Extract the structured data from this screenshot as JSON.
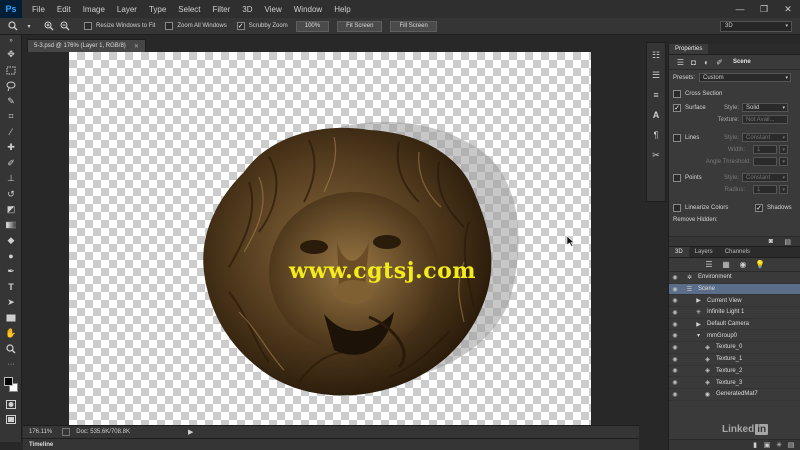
{
  "app": {
    "logo": "Ps",
    "menu": [
      "File",
      "Edit",
      "Image",
      "Layer",
      "Type",
      "Select",
      "Filter",
      "3D",
      "View",
      "Window",
      "Help"
    ],
    "window_controls": [
      "—",
      "❐",
      "✕"
    ]
  },
  "options": {
    "resize_windows": "Resize Windows to Fit",
    "resize_checked": false,
    "zoom_all": "Zoom All Windows",
    "zoom_all_checked": false,
    "scrubby_zoom": "Scrubby Zoom",
    "scrubby_checked": true,
    "btn_100": "100%",
    "btn_fit": "Fit Screen",
    "btn_fill": "Fill Screen",
    "workspace": "3D"
  },
  "document": {
    "tab_title": "5-3.psd @ 176% (Layer 1, RGB/8)",
    "watermark": "www.cgtsj.com"
  },
  "status": {
    "zoom": "176.11%",
    "doc_info": "Doc: 535.6K/708.8K"
  },
  "timeline": {
    "label": "Timeline"
  },
  "properties": {
    "tab": "Properties",
    "header": "Scene",
    "presets_label": "Presets:",
    "presets_value": "Custom",
    "cross_section": "Cross Section",
    "cross_section_checked": false,
    "surface": "Surface",
    "surface_checked": true,
    "surface_style_label": "Style:",
    "surface_style_value": "Solid",
    "texture_label": "Texture:",
    "texture_value": "Not Avail...",
    "lines": "Lines",
    "lines_checked": false,
    "lines_style_label": "Style:",
    "lines_style_value": "Constant",
    "width_label": "Width:",
    "width_value": "1",
    "angle_label": "Angle Threshold:",
    "points": "Points",
    "points_checked": false,
    "points_style_label": "Style:",
    "points_style_value": "Constant",
    "radius_label": "Radius:",
    "radius_value": "1",
    "linearize": "Linearize Colors",
    "linearize_checked": false,
    "shadows": "Shadows",
    "shadows_checked": true,
    "remove_hidden": "Remove Hidden:"
  },
  "panel3d": {
    "tabs": [
      "3D",
      "Layers",
      "Channels"
    ],
    "nodes": [
      {
        "name": "Environment",
        "indent": 0,
        "icon": "environment-icon",
        "glyph": "✲",
        "selected": false
      },
      {
        "name": "Scene",
        "indent": 0,
        "icon": "scene-icon",
        "glyph": "☰",
        "selected": true
      },
      {
        "name": "Current View",
        "indent": 1,
        "icon": "camera-icon",
        "glyph": "▶",
        "selected": false
      },
      {
        "name": "Infinite Light 1",
        "indent": 1,
        "icon": "light-icon",
        "glyph": "✳",
        "selected": false
      },
      {
        "name": "Default Camera",
        "indent": 1,
        "icon": "camera-icon",
        "glyph": "▶",
        "selected": false
      },
      {
        "name": "mmGroup0",
        "indent": 1,
        "icon": "group-icon",
        "glyph": "▾",
        "selected": false
      },
      {
        "name": "Texture_0",
        "indent": 2,
        "icon": "mesh-icon",
        "glyph": "◈",
        "selected": false
      },
      {
        "name": "Texture_1",
        "indent": 2,
        "icon": "mesh-icon",
        "glyph": "◈",
        "selected": false
      },
      {
        "name": "Texture_2",
        "indent": 2,
        "icon": "mesh-icon",
        "glyph": "◈",
        "selected": false
      },
      {
        "name": "Texture_3",
        "indent": 2,
        "icon": "mesh-icon",
        "glyph": "◈",
        "selected": false
      },
      {
        "name": "GeneratedMat7",
        "indent": 2,
        "icon": "material-icon",
        "glyph": "◉",
        "selected": false
      }
    ]
  },
  "watermark_brand": {
    "text": "Linked",
    "in": "in"
  }
}
